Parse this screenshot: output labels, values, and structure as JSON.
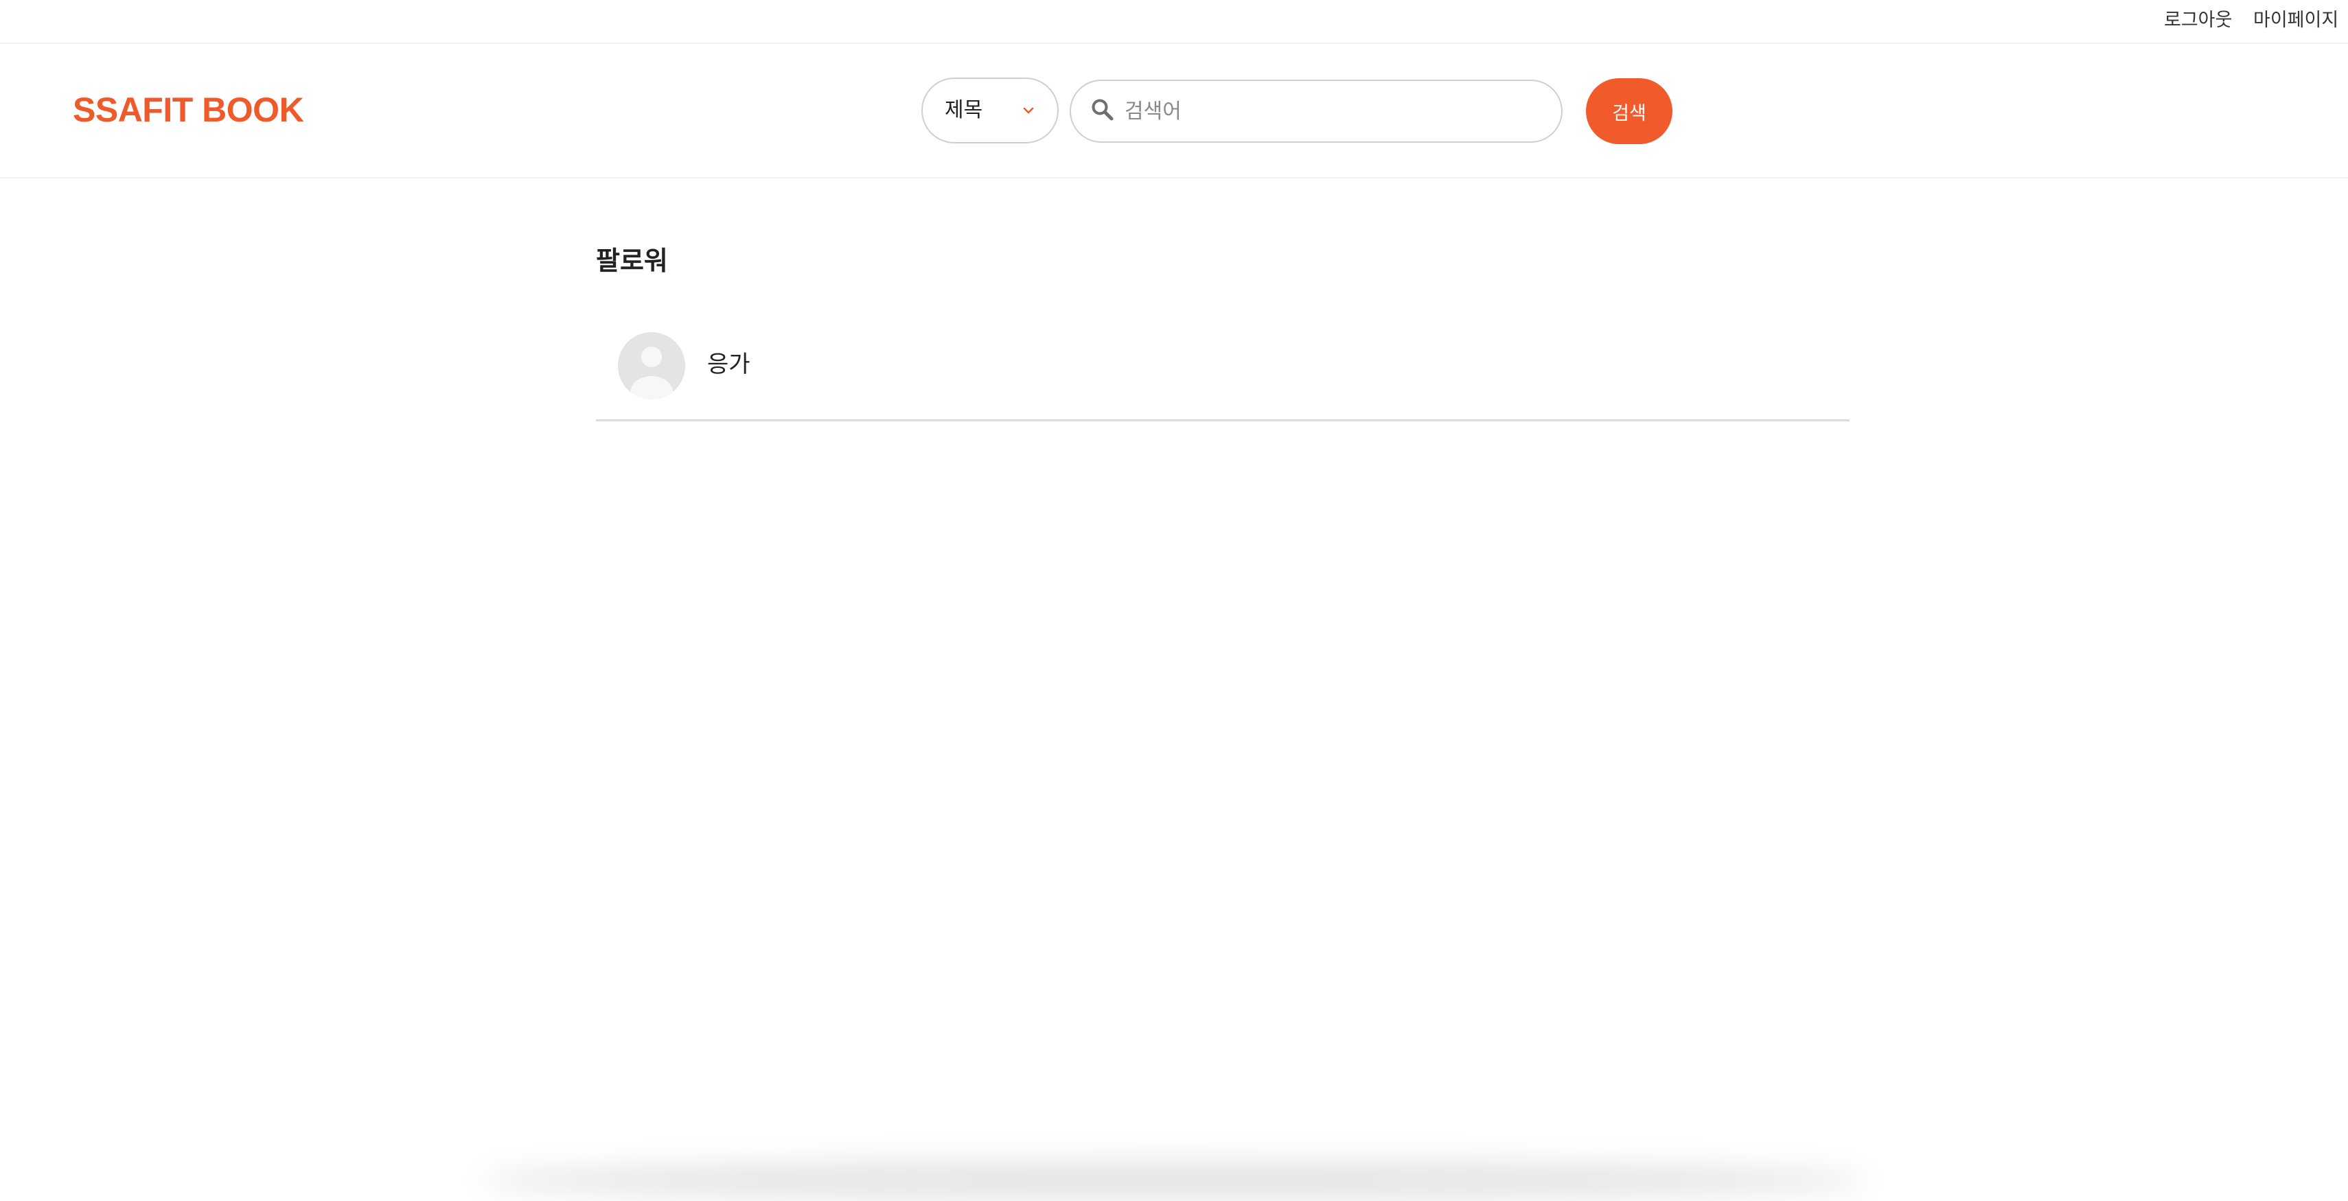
{
  "topbar": {
    "logout_label": "로그아웃",
    "mypage_label": "마이페이지"
  },
  "header": {
    "logo": "SSAFIT BOOK",
    "search_type": {
      "selected": "제목",
      "icon": "chevron-down-icon"
    },
    "search": {
      "placeholder": "검색어",
      "value": "",
      "icon": "search-icon"
    },
    "search_button_label": "검색"
  },
  "main": {
    "title": "팔로워",
    "followers": [
      {
        "name": "응가",
        "avatar": "default-avatar-icon"
      }
    ]
  },
  "colors": {
    "accent": "#f15a2b",
    "logo": "#f05a2a",
    "divider": "#dcdcdc"
  }
}
